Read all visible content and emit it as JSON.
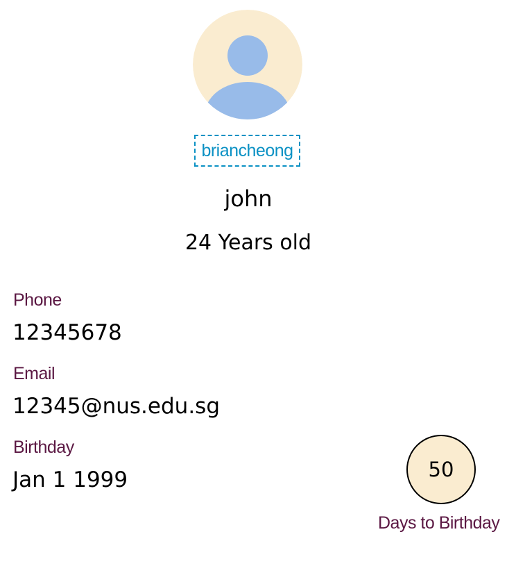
{
  "profile": {
    "username": "briancheong",
    "name": "john",
    "age": "24 Years old"
  },
  "contact": {
    "phone_label": "Phone",
    "phone_value": "12345678",
    "email_label": "Email",
    "email_value": "12345@nus.edu.sg",
    "birthday_label": "Birthday",
    "birthday_value": "Jan 1 1999"
  },
  "countdown": {
    "days": "50",
    "label": "Days to Birthday"
  },
  "colors": {
    "avatar_bg": "#faecd0",
    "avatar_figure": "#98bbe9",
    "username": "#0b91c4",
    "label": "#5b1843",
    "countdown_bg": "#faecd0"
  },
  "icons": {
    "avatar": "user-avatar-icon"
  }
}
